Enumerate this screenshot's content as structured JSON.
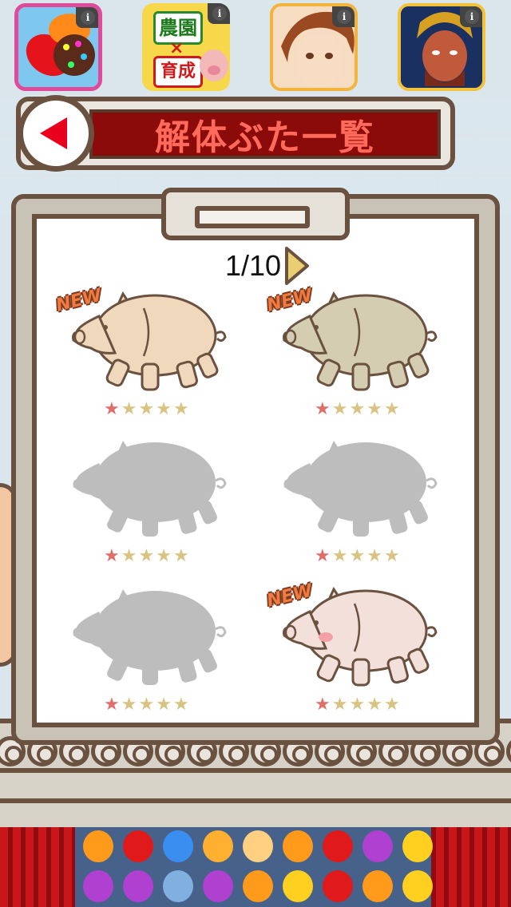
{
  "ads": [
    {
      "name": "candy-crush",
      "info": "i"
    },
    {
      "name": "farm-game",
      "line1": "農園",
      "mark": "×",
      "line2": "育成",
      "info": "i"
    },
    {
      "name": "anime-game",
      "info": "i"
    },
    {
      "name": "warrior-game",
      "info": "i"
    }
  ],
  "header": {
    "title": "解体ぶた一覧"
  },
  "pager": {
    "text": "1/10"
  },
  "pigs": [
    {
      "new": "NEW",
      "state": "unlocked",
      "color": "#f0d8bc",
      "stars": 1
    },
    {
      "new": "NEW",
      "state": "unlocked",
      "color": "#d4cdb2",
      "stars": 1
    },
    {
      "new": "",
      "state": "locked",
      "color": "#bdbdbd",
      "stars": 1
    },
    {
      "new": "",
      "state": "locked",
      "color": "#bdbdbd",
      "stars": 1
    },
    {
      "new": "",
      "state": "locked",
      "color": "#bdbdbd",
      "stars": 1
    },
    {
      "new": "NEW",
      "state": "unlocked",
      "color": "#f3e0da",
      "stars": 1
    }
  ],
  "colors": {
    "frame": "#6b5240",
    "title_bg": "#8b0a0a",
    "title_text": "#ff6a5a",
    "back_arrow": "#e8001c",
    "star_on": "#e06e6a",
    "star_off": "#d8c382"
  }
}
